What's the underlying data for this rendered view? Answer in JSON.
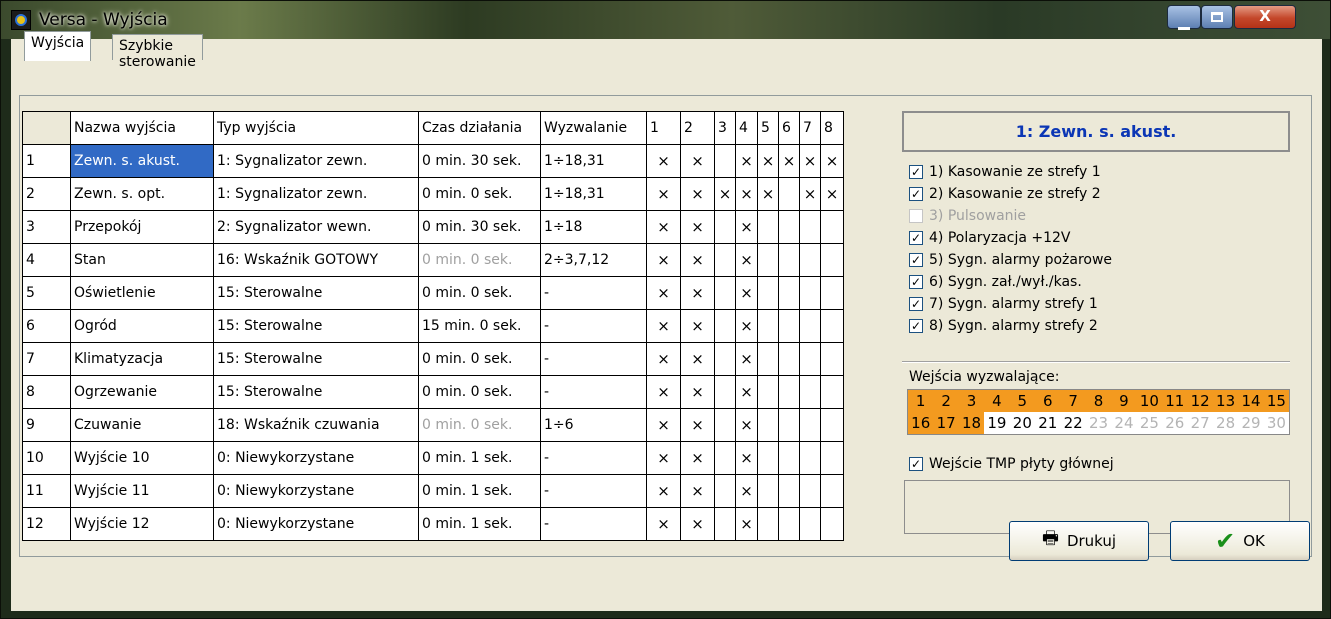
{
  "window": {
    "title": "Versa - Wyjścia"
  },
  "tabs": [
    "Wyjścia",
    "Szybkie sterowanie"
  ],
  "table": {
    "headers": [
      "",
      "Nazwa wyjścia",
      "Typ wyjścia",
      "Czas działania",
      "Wyzwalanie",
      "1",
      "2",
      "3",
      "4",
      "5",
      "6",
      "7",
      "8"
    ],
    "rows": [
      {
        "n": "1",
        "name": "Zewn. s. akust.",
        "type": "1: Sygnalizator zewn.",
        "time": "0 min. 30 sek.",
        "trig": "1÷18,31",
        "z": [
          "×",
          "×",
          "",
          "×",
          "×",
          "×",
          "×",
          "×"
        ],
        "selected": true
      },
      {
        "n": "2",
        "name": "Zewn. s. opt.",
        "type": "1: Sygnalizator zewn.",
        "time": "0 min. 0 sek.",
        "trig": "1÷18,31",
        "z": [
          "×",
          "×",
          "×",
          "×",
          "×",
          "",
          "×",
          "×"
        ]
      },
      {
        "n": "3",
        "name": "Przepokój",
        "type": "2: Sygnalizator wewn.",
        "time": "0 min. 30 sek.",
        "trig": "1÷18",
        "z": [
          "×",
          "×",
          "",
          "×",
          "",
          "",
          "",
          ""
        ]
      },
      {
        "n": "4",
        "name": "Stan",
        "type": "16: Wskaźnik GOTOWY",
        "time": "0 min. 0 sek.",
        "trig": "2÷3,7,12",
        "z": [
          "×",
          "×",
          "",
          "×",
          "",
          "",
          "",
          ""
        ],
        "dimTime": true
      },
      {
        "n": "5",
        "name": "Oświetlenie",
        "type": "15: Sterowalne",
        "time": "0 min. 0 sek.",
        "trig": "-",
        "z": [
          "×",
          "×",
          "",
          "×",
          "",
          "",
          "",
          ""
        ]
      },
      {
        "n": "6",
        "name": "Ogród",
        "type": "15: Sterowalne",
        "time": "15 min. 0 sek.",
        "trig": "-",
        "z": [
          "×",
          "×",
          "",
          "×",
          "",
          "",
          "",
          ""
        ]
      },
      {
        "n": "7",
        "name": "Klimatyzacja",
        "type": "15: Sterowalne",
        "time": "0 min. 0 sek.",
        "trig": "-",
        "z": [
          "×",
          "×",
          "",
          "×",
          "",
          "",
          "",
          ""
        ]
      },
      {
        "n": "8",
        "name": "Ogrzewanie",
        "type": "15: Sterowalne",
        "time": "0 min. 0 sek.",
        "trig": "-",
        "z": [
          "×",
          "×",
          "",
          "×",
          "",
          "",
          "",
          ""
        ]
      },
      {
        "n": "9",
        "name": "Czuwanie",
        "type": "18: Wskaźnik czuwania",
        "time": "0 min. 0 sek.",
        "trig": "1÷6",
        "z": [
          "×",
          "×",
          "",
          "×",
          "",
          "",
          "",
          ""
        ],
        "dimTime": true
      },
      {
        "n": "10",
        "name": "Wyjście 10",
        "type": "0: Niewykorzystane",
        "time": "0 min. 1 sek.",
        "trig": "-",
        "z": [
          "×",
          "×",
          "",
          "×",
          "",
          "",
          "",
          ""
        ]
      },
      {
        "n": "11",
        "name": "Wyjście 11",
        "type": "0: Niewykorzystane",
        "time": "0 min. 1 sek.",
        "trig": "-",
        "z": [
          "×",
          "×",
          "",
          "×",
          "",
          "",
          "",
          ""
        ]
      },
      {
        "n": "12",
        "name": "Wyjście 12",
        "type": "0: Niewykorzystane",
        "time": "0 min. 1 sek.",
        "trig": "-",
        "z": [
          "×",
          "×",
          "",
          "×",
          "",
          "",
          "",
          ""
        ]
      }
    ]
  },
  "panel": {
    "header": "1: Zewn. s. akust.",
    "options": [
      {
        "label": "1) Kasowanie ze strefy 1",
        "checked": true,
        "enabled": true
      },
      {
        "label": "2) Kasowanie ze strefy 2",
        "checked": true,
        "enabled": true
      },
      {
        "label": "3) Pulsowanie",
        "checked": false,
        "enabled": false
      },
      {
        "label": "4) Polaryzacja +12V",
        "checked": true,
        "enabled": true
      },
      {
        "label": "5) Sygn. alarmy pożarowe",
        "checked": true,
        "enabled": true
      },
      {
        "label": "6) Sygn. zał./wył./kas.",
        "checked": true,
        "enabled": true
      },
      {
        "label": "7) Sygn. alarmy strefy 1",
        "checked": true,
        "enabled": true
      },
      {
        "label": "8) Sygn. alarmy strefy 2",
        "checked": true,
        "enabled": true
      }
    ],
    "inputs_label": "Wejścia wyzwalające:",
    "inputs": [
      {
        "n": "1",
        "s": "on"
      },
      {
        "n": "2",
        "s": "on"
      },
      {
        "n": "3",
        "s": "on"
      },
      {
        "n": "4",
        "s": "on"
      },
      {
        "n": "5",
        "s": "on"
      },
      {
        "n": "6",
        "s": "on"
      },
      {
        "n": "7",
        "s": "on"
      },
      {
        "n": "8",
        "s": "on"
      },
      {
        "n": "9",
        "s": "on"
      },
      {
        "n": "10",
        "s": "on"
      },
      {
        "n": "11",
        "s": "on"
      },
      {
        "n": "12",
        "s": "on"
      },
      {
        "n": "13",
        "s": "on"
      },
      {
        "n": "14",
        "s": "on"
      },
      {
        "n": "15",
        "s": "on"
      },
      {
        "n": "16",
        "s": "on"
      },
      {
        "n": "17",
        "s": "on"
      },
      {
        "n": "18",
        "s": "on"
      },
      {
        "n": "19",
        "s": "off"
      },
      {
        "n": "20",
        "s": "off"
      },
      {
        "n": "21",
        "s": "off"
      },
      {
        "n": "22",
        "s": "off"
      },
      {
        "n": "23",
        "s": "na"
      },
      {
        "n": "24",
        "s": "na"
      },
      {
        "n": "25",
        "s": "na"
      },
      {
        "n": "26",
        "s": "na"
      },
      {
        "n": "27",
        "s": "na"
      },
      {
        "n": "28",
        "s": "na"
      },
      {
        "n": "29",
        "s": "na"
      },
      {
        "n": "30",
        "s": "na"
      }
    ],
    "tmp_label": "Wejście TMP płyty głównej",
    "tmp_checked": true,
    "colors": {
      "active": "#f39a1f",
      "header_text": "#0b36b5",
      "selection": "#316ac5"
    }
  },
  "buttons": {
    "print": "Drukuj",
    "ok": "OK"
  },
  "icons": {
    "print": "printer-icon",
    "ok": "checkmark-icon",
    "app": "app-icon"
  }
}
